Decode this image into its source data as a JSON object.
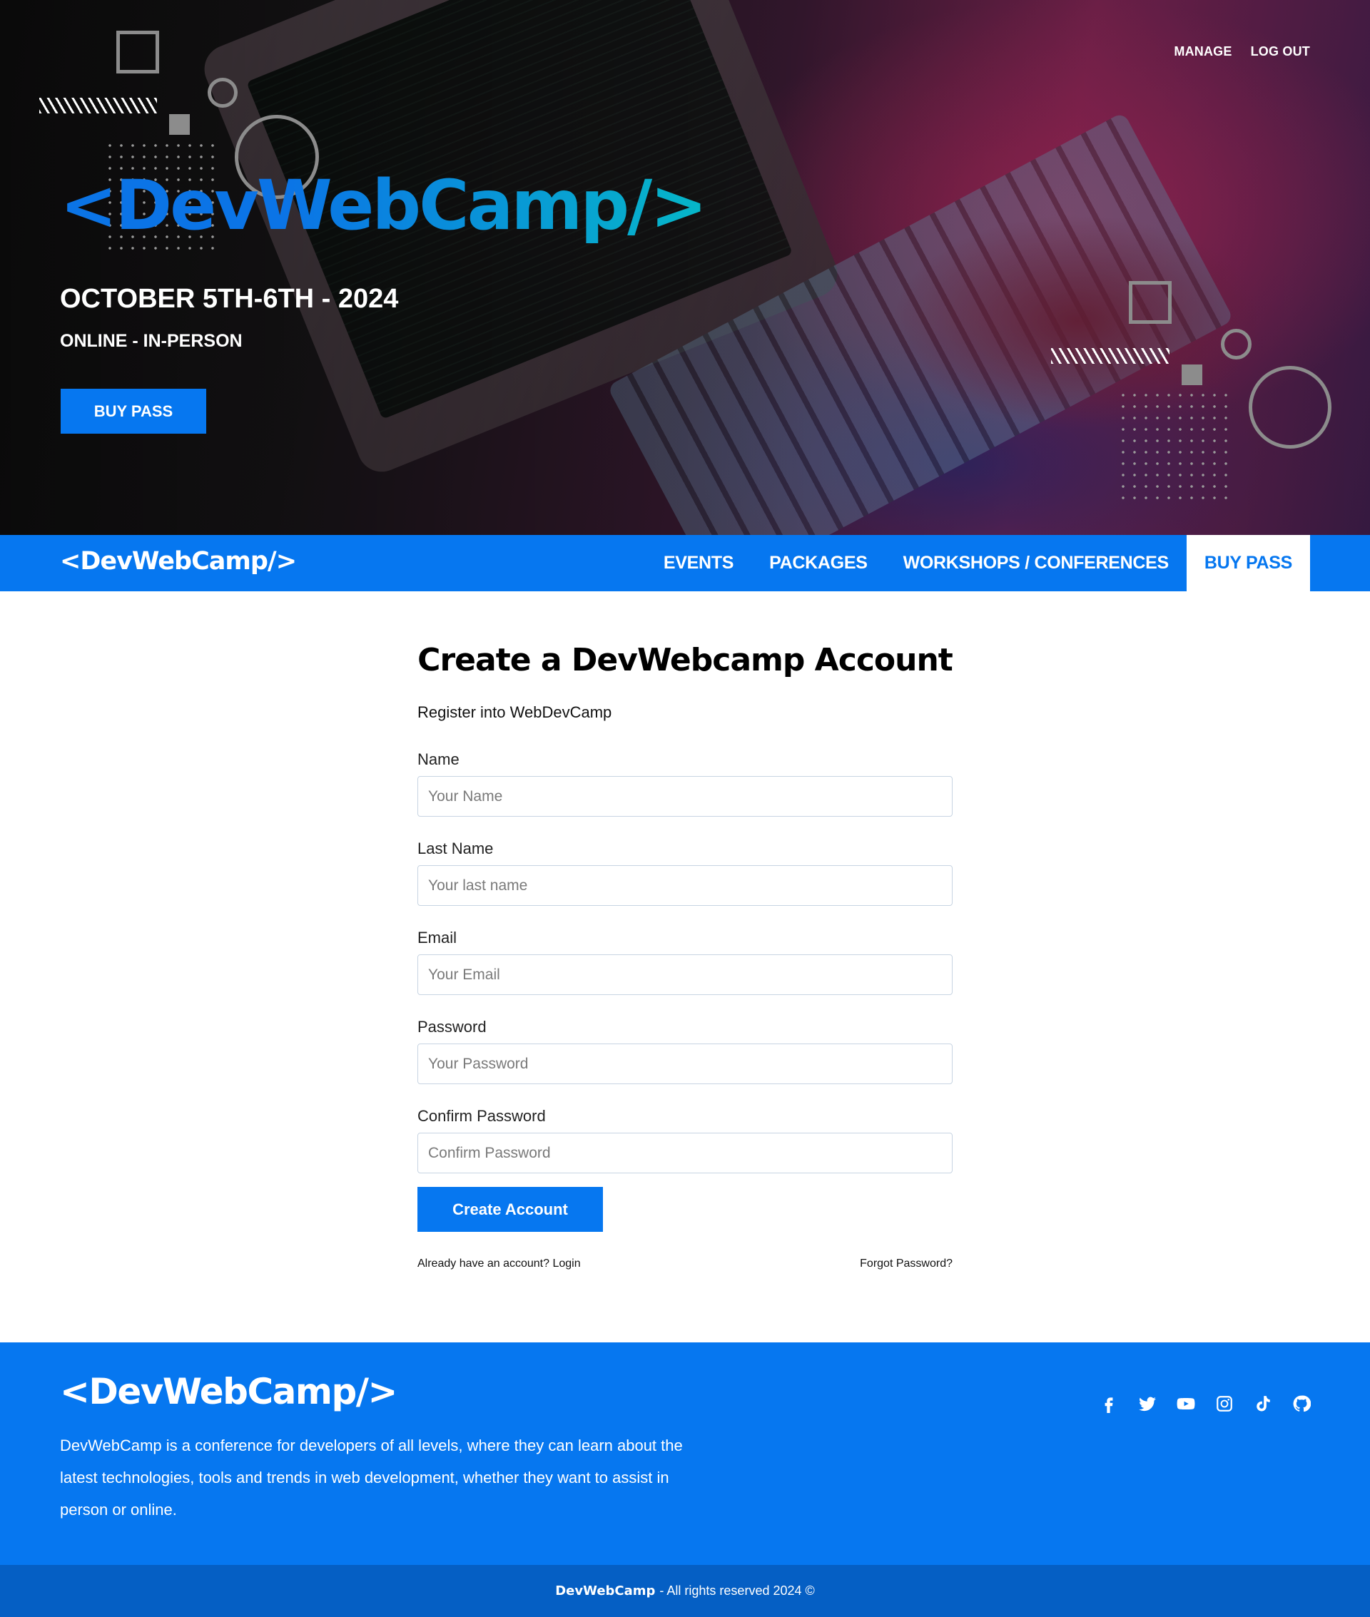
{
  "hero": {
    "top_links": [
      "MANAGE",
      "LOG OUT"
    ],
    "logo": "<DevWebCamp/>",
    "date": "OCTOBER 5TH-6TH - 2024",
    "mode": "ONLINE - IN-PERSON",
    "button": "BUY PASS"
  },
  "nav": {
    "logo": "<DevWebCamp/>",
    "items": [
      {
        "label": "EVENTS"
      },
      {
        "label": "PACKAGES"
      },
      {
        "label": "WORKSHOPS / CONFERENCES"
      },
      {
        "label": "BUY PASS",
        "active": true
      }
    ]
  },
  "form": {
    "title": "Create a DevWebcamp Account",
    "intro": "Register into WebDevCamp",
    "fields": [
      {
        "label": "Name",
        "placeholder": "Your Name",
        "value": ""
      },
      {
        "label": "Last Name",
        "placeholder": "Your last name",
        "value": ""
      },
      {
        "label": "Email",
        "placeholder": "Your Email",
        "value": ""
      },
      {
        "label": "Password",
        "placeholder": "Your Password",
        "value": ""
      },
      {
        "label": "Confirm Password",
        "placeholder": "Confirm Password",
        "value": ""
      }
    ],
    "submit": "Create Account",
    "login_link": "Already have an account? Login",
    "forgot_link": "Forgot Password?"
  },
  "footer": {
    "logo": "<DevWebCamp/>",
    "description": "DevWebCamp is a conference for developers of all levels, where they can learn about the latest technologies, tools and trends in web development, whether they want to assist in person or online.",
    "socials": [
      "facebook-icon",
      "twitter-icon",
      "youtube-icon",
      "instagram-icon",
      "tiktok-icon",
      "github-icon"
    ],
    "copyright_brand": "DevWebCamp",
    "copyright_text": "- All rights reserved 2024 ©"
  },
  "colors": {
    "primary": "#0677f0",
    "primary_dark": "#055fc4",
    "logo_gradient_end": "#06b7c8"
  }
}
